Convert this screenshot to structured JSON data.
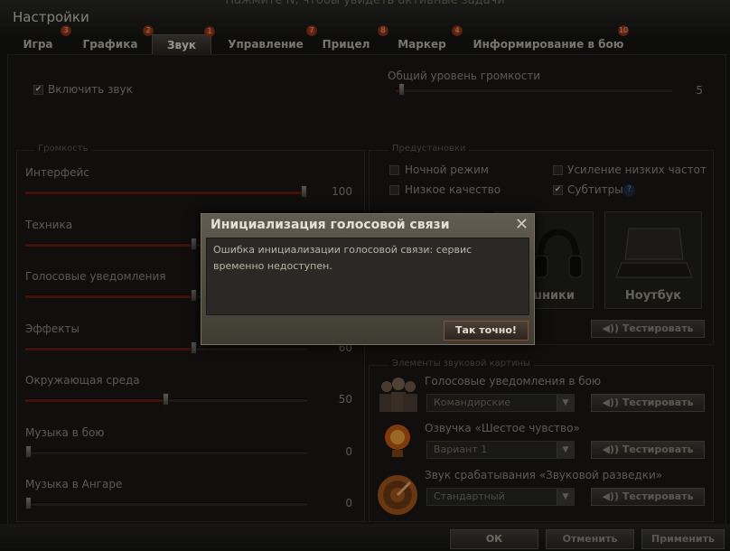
{
  "hint": "Нажмите N, чтобы увидеть активные задачи",
  "window_title": "Настройки",
  "tabs": [
    {
      "label": "Игра",
      "badge": "3"
    },
    {
      "label": "Графика",
      "badge": "2"
    },
    {
      "label": "Звук",
      "badge": "1"
    },
    {
      "label": "Управление",
      "badge": "7"
    },
    {
      "label": "Прицел",
      "badge": "8"
    },
    {
      "label": "Маркер",
      "badge": "4"
    },
    {
      "label": "Информирование в бою",
      "badge": "10"
    }
  ],
  "enable_sound": {
    "label": "Включить звук",
    "checked": true
  },
  "master_volume": {
    "label": "Общий уровень громкости",
    "value": "5",
    "level": 0.01
  },
  "volume_group": {
    "title": "Громкость",
    "sliders": [
      {
        "label": "Интерфейс",
        "value": "100",
        "level": 1.0
      },
      {
        "label": "Техника",
        "value": "",
        "level": 0.6
      },
      {
        "label": "Голосовые уведомления",
        "value": "",
        "level": 0.6
      },
      {
        "label": "Эффекты",
        "value": "60",
        "level": 0.6
      },
      {
        "label": "Окружающая среда",
        "value": "50",
        "level": 0.5
      },
      {
        "label": "Музыка в бою",
        "value": "0",
        "level": 0.0
      },
      {
        "label": "Музыка в Ангаре",
        "value": "0",
        "level": 0.0
      }
    ]
  },
  "presets": {
    "title": "Предустановки",
    "options": [
      {
        "label": "Ночной режим",
        "checked": false
      },
      {
        "label": "Усиление низких частот",
        "checked": false
      },
      {
        "label": "Низкое качество",
        "checked": false
      },
      {
        "label": "Субтитры",
        "checked": true
      }
    ],
    "cards": [
      {
        "label": "ушники",
        "icon": "headphones-icon"
      },
      {
        "label": "Ноутбук",
        "icon": "laptop-icon"
      }
    ],
    "test_label": "Тестировать",
    "help_icon": "?"
  },
  "sound_picture": {
    "title": "Элементы звуковой картины",
    "rows": [
      {
        "label": "Голосовые уведомления в бою",
        "value": "Командирские",
        "icon": "crew-icon",
        "button": "Тестировать"
      },
      {
        "label": "Озвучка «Шестое чувство»",
        "value": "Вариант 1",
        "icon": "lightbulb-icon",
        "button": "Тестировать"
      },
      {
        "label": "Звук срабатывания «Звуковой разведки»",
        "value": "Стандартный",
        "icon": "radar-icon",
        "button": "Тестировать"
      }
    ]
  },
  "footer": {
    "ok": "ОК",
    "cancel": "Отменить",
    "apply": "Применить"
  },
  "dialog": {
    "title": "Инициализация голосовой связи",
    "message": "Ошибка инициализации голосовой связи: сервис временно недоступен.",
    "button": "Так точно!",
    "close": "✕"
  }
}
